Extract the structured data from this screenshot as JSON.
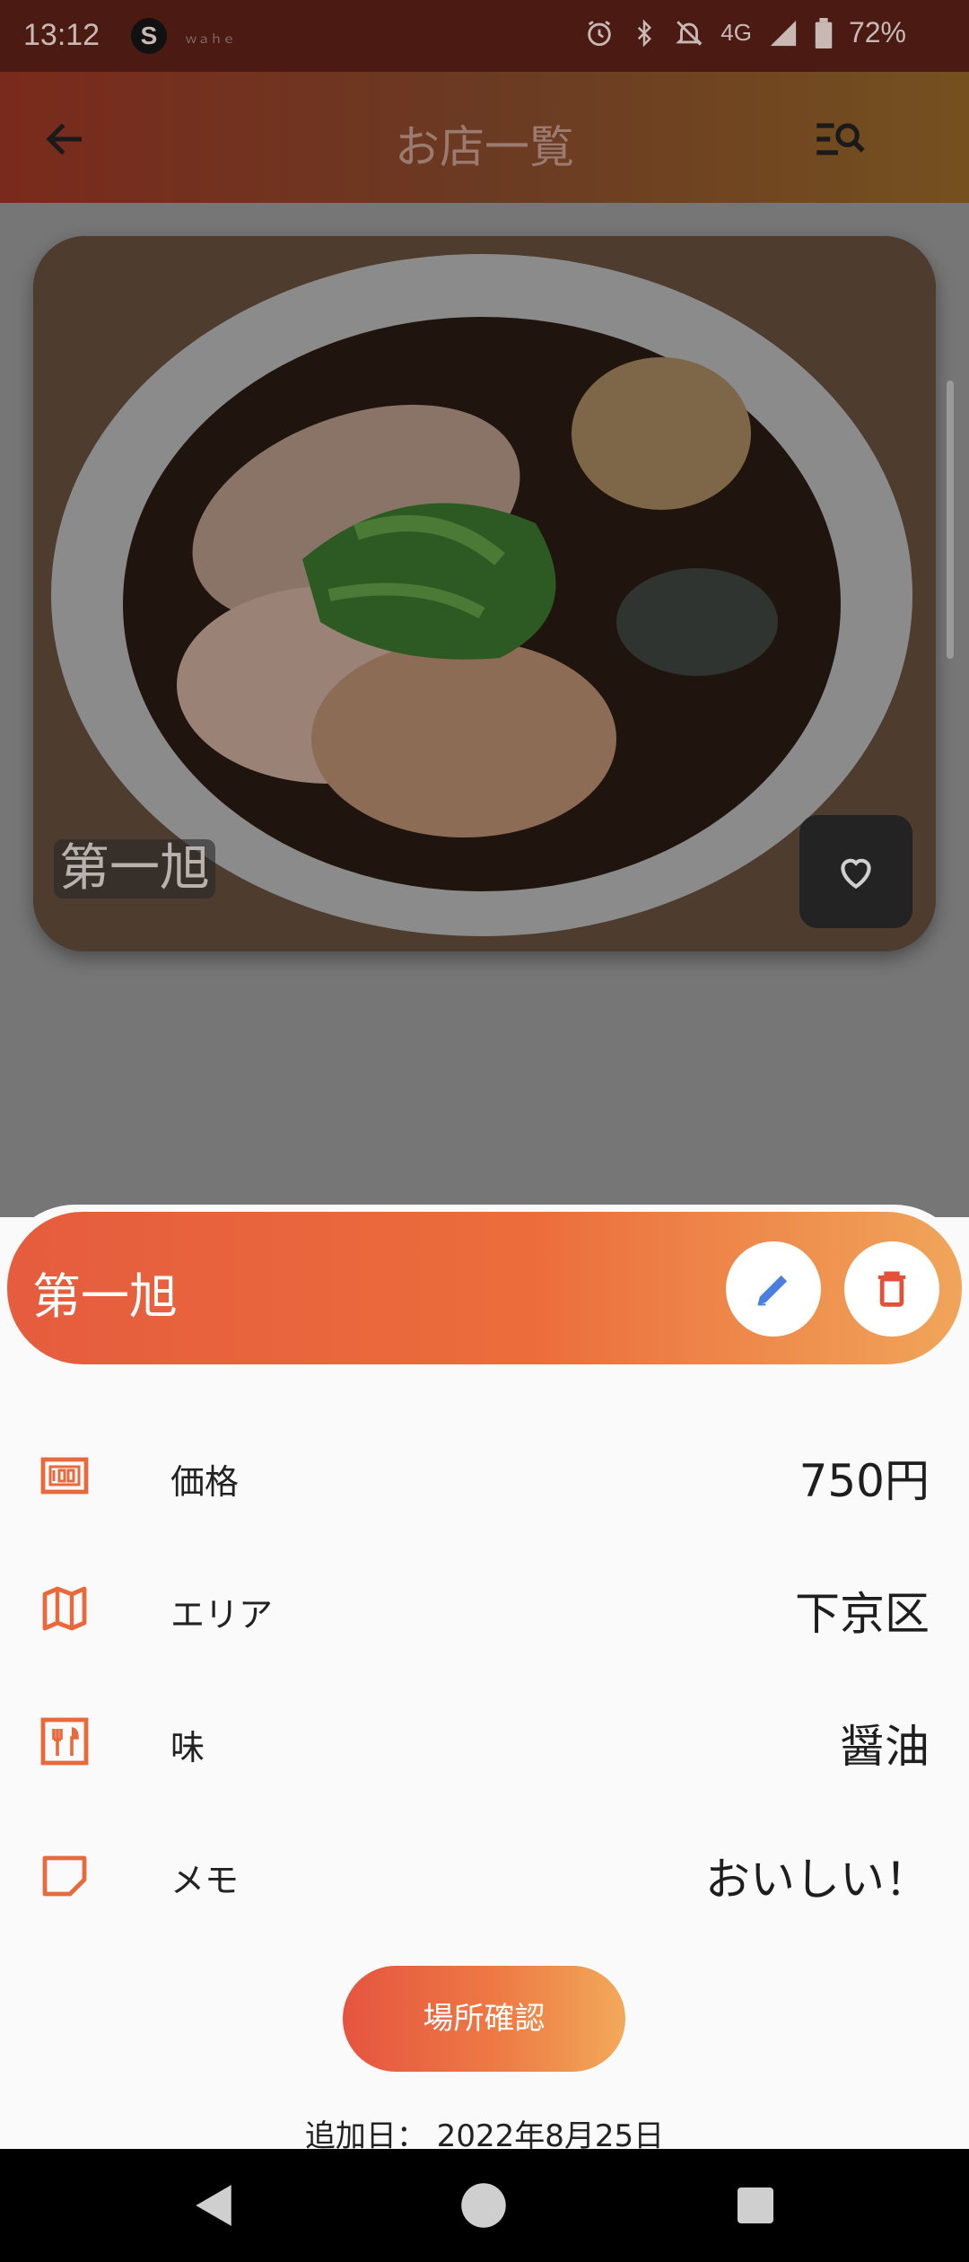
{
  "status_bar": {
    "time": "13:12",
    "app_icon_letter": "S",
    "small_text": "ｗａｈｅ",
    "network": "4G",
    "battery": "72%"
  },
  "app_bar": {
    "title": "お店一覧"
  },
  "shop_card": {
    "name_overlay": "第一旭"
  },
  "sheet": {
    "title": "第一旭",
    "rows": [
      {
        "label": "価格",
        "value": "750円",
        "icon": "price-100-icon"
      },
      {
        "label": "エリア",
        "value": "下京区",
        "icon": "map-icon"
      },
      {
        "label": "味",
        "value": "醤油",
        "icon": "restaurant-menu-icon"
      },
      {
        "label": "メモ",
        "value": "おいしい！",
        "icon": "note-icon"
      }
    ],
    "location_button": "場所確認",
    "added_date": "追加日： 2022年8月25日"
  },
  "colors": {
    "accent": "#e86a3c",
    "gradient_start": "#e55c3e",
    "gradient_end": "#f0a55a",
    "edit_icon": "#4a7fe0",
    "delete_icon": "#e5503a"
  }
}
